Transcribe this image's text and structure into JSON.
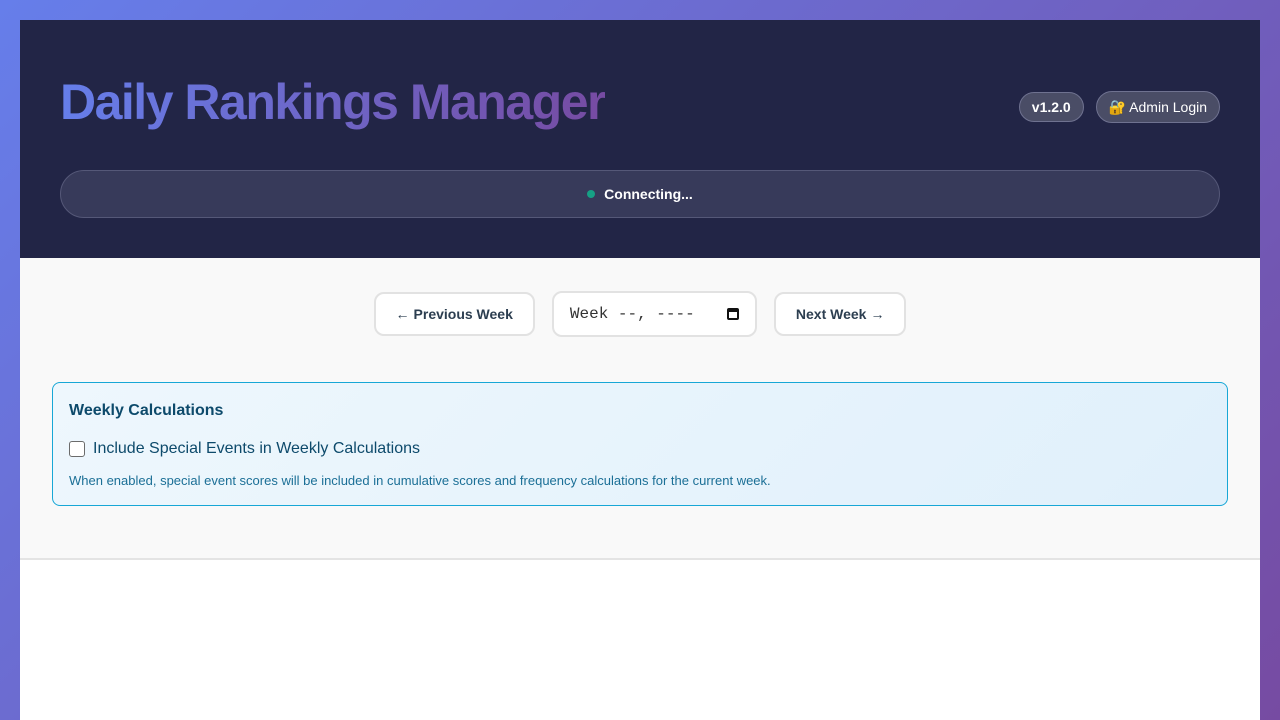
{
  "header": {
    "title": "Daily Rankings Manager",
    "version": "v1.2.0",
    "admin_login_label": "Admin Login",
    "admin_login_icon": "lock-key-icon",
    "status": {
      "text": "Connecting...",
      "dot_color": "#16a085"
    }
  },
  "week_nav": {
    "prev_arrow": "←",
    "prev_label": "Previous Week",
    "week_placeholder": "Week --, ----",
    "next_label": "Next Week",
    "next_arrow": "→"
  },
  "weekly_calculations": {
    "title": "Weekly Calculations",
    "checkbox_label": "Include Special Events in Weekly Calculations",
    "checked": false,
    "help_text": "When enabled, special event scores will be included in cumulative scores and frequency calculations for the current week."
  },
  "colors": {
    "brand_gradient_start": "#667eea",
    "brand_gradient_end": "#764ba2",
    "header_bg": "#222546",
    "panel_border": "#17a7d6"
  }
}
